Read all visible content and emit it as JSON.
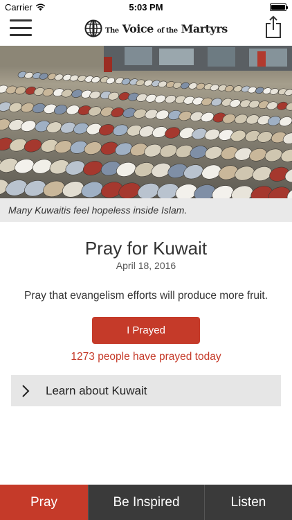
{
  "status_bar": {
    "carrier": "Carrier",
    "time": "5:03 PM"
  },
  "nav": {
    "logo_the": "The",
    "logo_main": "Voice",
    "logo_of_the": "of the",
    "logo_end": "Martyrs"
  },
  "hero": {
    "caption": "Many Kuwaitis feel hopeless inside Islam."
  },
  "prayer": {
    "title": "Pray for Kuwait",
    "date": "April 18, 2016",
    "text": "Pray that evangelism efforts will produce more fruit.",
    "button_label": "I Prayed",
    "count_text": "1273 people have prayed today"
  },
  "learn": {
    "label": "Learn about Kuwait"
  },
  "tabs": [
    {
      "label": "Pray",
      "active": true
    },
    {
      "label": "Be Inspired",
      "active": false
    },
    {
      "label": "Listen",
      "active": false
    }
  ],
  "colors": {
    "accent": "#c53a29",
    "tab_bar": "#3a3a3a",
    "caption_bg": "#e9e9e9",
    "row_bg": "#e6e6e6"
  },
  "icons": {
    "menu": "hamburger-icon",
    "share": "share-icon",
    "logo": "globe-icon",
    "chevron": "chevron-right-icon",
    "wifi": "wifi-icon",
    "battery": "battery-icon"
  }
}
